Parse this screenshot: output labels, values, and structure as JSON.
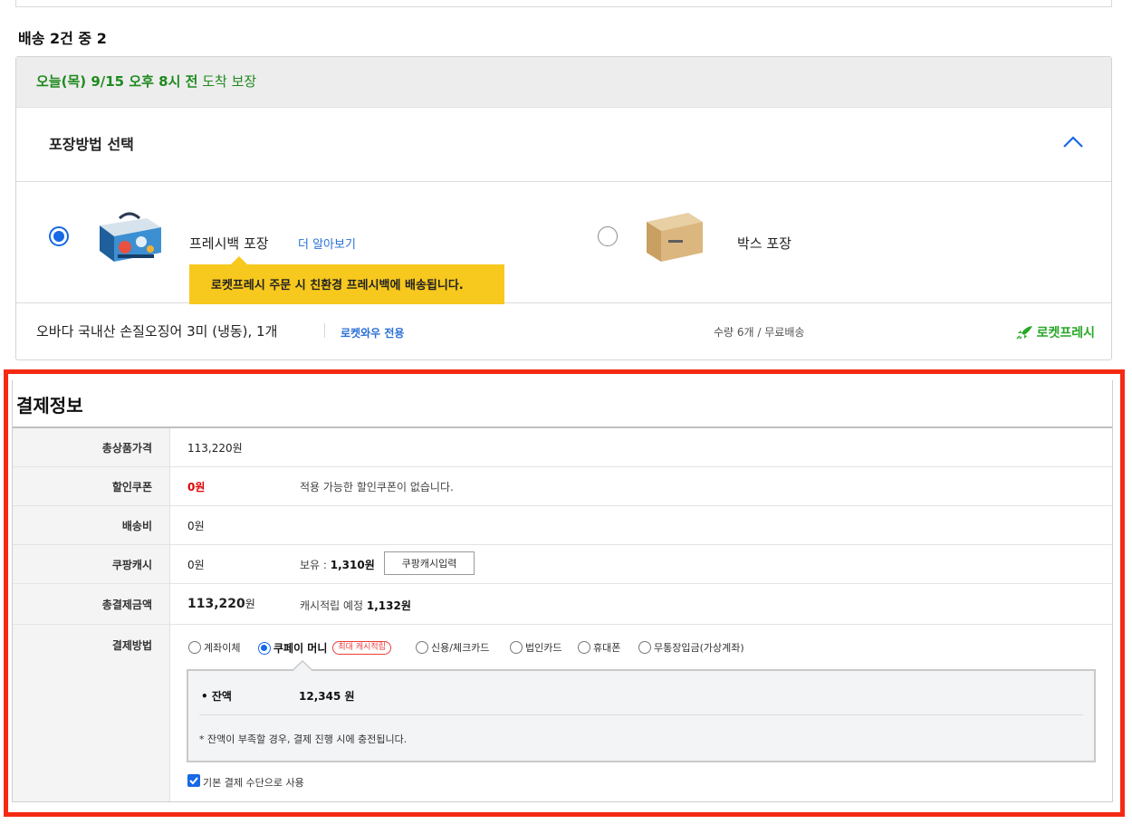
{
  "shipment": {
    "count_label": "배송 2건 중 2"
  },
  "delivery": {
    "guarantee_bold": "오늘(목) 9/15 오후 8시 전",
    "guarantee_rest": " 도착 보장"
  },
  "packaging": {
    "title": "포장방법 선택",
    "options": [
      {
        "label": "프레시백 포장",
        "selected": true,
        "link": "더 알아보기"
      },
      {
        "label": "박스 포장",
        "selected": false
      }
    ],
    "tip": "로켓프레시 주문 시 친환경 프레시백에 배송됩니다."
  },
  "item": {
    "name": "오바다 국내산 손질오징어 3미 (냉동), 1개",
    "tag": "로켓와우 전용",
    "qty": "수량 6개 / 무료배송",
    "badge": "로켓프레시"
  },
  "payment": {
    "title": "결제정보",
    "rows": {
      "total_product": {
        "label": "총상품가격",
        "value": "113,220원"
      },
      "coupon": {
        "label": "할인쿠폰",
        "value": "0원",
        "note": "적용 가능한 할인쿠폰이 없습니다."
      },
      "shipping": {
        "label": "배송비",
        "value": "0원"
      },
      "cash": {
        "label": "쿠팡캐시",
        "value": "0원",
        "note_prefix": "보유 : ",
        "note_amount": "1,310원",
        "button": "쿠팡캐시입력"
      },
      "total_payment": {
        "label": "총결제금액",
        "value": "113,220",
        "unit": "원",
        "note_prefix": "캐시적립 예정 ",
        "note_amount": "1,132원"
      },
      "method": {
        "label": "결제방법"
      }
    },
    "methods": [
      {
        "label": "계좌이체",
        "selected": false
      },
      {
        "label": "쿠페이 머니",
        "selected": true,
        "badge": "최대 캐시적립"
      },
      {
        "label": "신용/체크카드",
        "selected": false
      },
      {
        "label": "법인카드",
        "selected": false
      },
      {
        "label": "휴대폰",
        "selected": false
      },
      {
        "label": "무통장입금(가상계좌)",
        "selected": false
      }
    ],
    "balance": {
      "label": "• 잔액",
      "value": "12,345 원",
      "note": "* 잔액이 부족할 경우, 결제 진행 시에 충전됩니다."
    },
    "default_checkbox": {
      "label": "기본 결제 수단으로 사용",
      "checked": true
    }
  },
  "colors": {
    "accent_blue": "#1769e6",
    "highlight_border": "#f52a12",
    "guarantee_green": "#1f8a1f",
    "tip_yellow": "#f7c81d",
    "price_red": "#e00000"
  }
}
